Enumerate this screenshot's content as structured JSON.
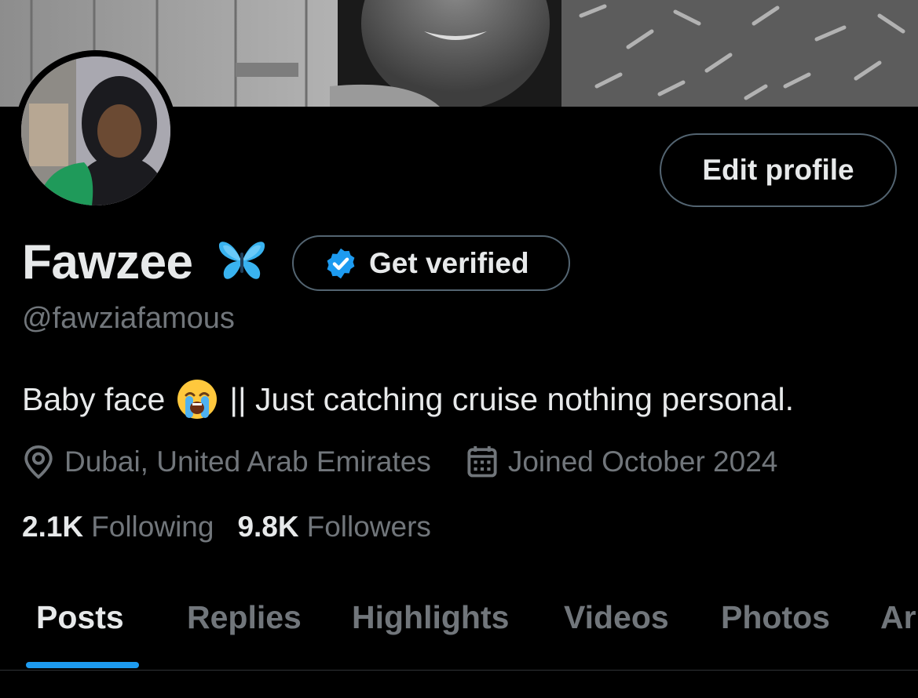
{
  "profile": {
    "name": "Fawzee",
    "name_emoji": "butterfly",
    "handle": "@fawziafamous",
    "bio_before": "Baby face",
    "bio_emoji": "loudly-crying-face",
    "bio_after": "|| Just catching cruise nothing personal.",
    "location": "Dubai, United Arab Emirates",
    "joined": "Joined October 2024"
  },
  "actions": {
    "edit_profile": "Edit profile",
    "get_verified": "Get verified"
  },
  "stats": {
    "following_count": "2.1K",
    "following_label": "Following",
    "followers_count": "9.8K",
    "followers_label": "Followers"
  },
  "tabs": [
    {
      "label": "Posts",
      "active": true
    },
    {
      "label": "Replies",
      "active": false
    },
    {
      "label": "Highlights",
      "active": false
    },
    {
      "label": "Videos",
      "active": false
    },
    {
      "label": "Photos",
      "active": false
    },
    {
      "label": "Ar",
      "active": false
    }
  ],
  "colors": {
    "background": "#000000",
    "text_primary": "#e7e9ea",
    "text_secondary": "#71767b",
    "border": "#536471",
    "accent": "#1d9bf0"
  }
}
